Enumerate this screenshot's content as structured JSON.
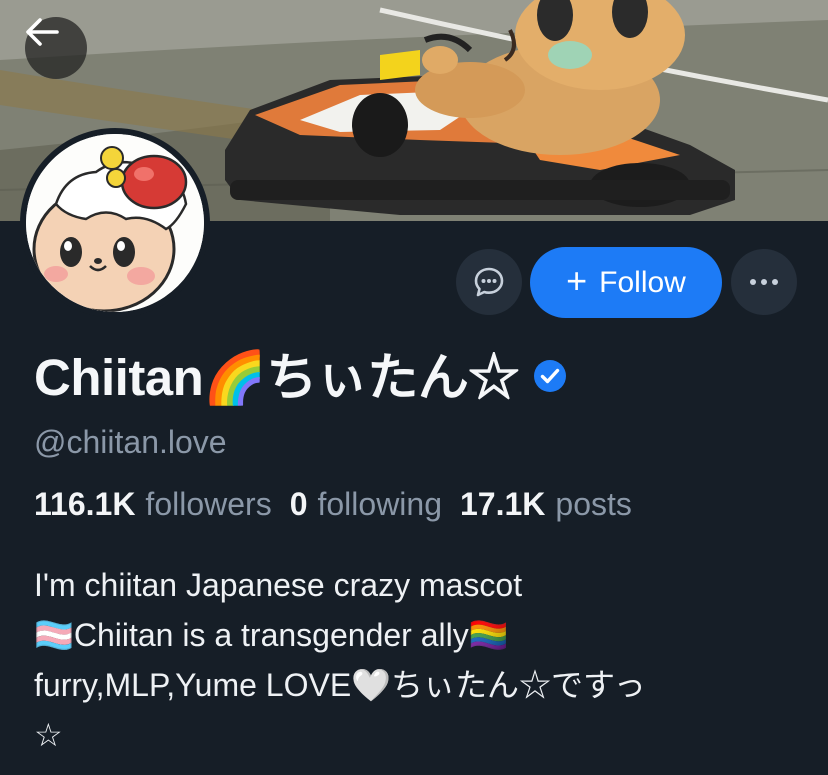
{
  "banner": {
    "description_icon": "kart-banner-image"
  },
  "back_button": {
    "icon": "arrow-left-icon"
  },
  "actions": {
    "message_icon": "chat-bubble-icon",
    "follow_label": "Follow",
    "follow_plus": "+",
    "more_icon": "ellipsis-icon"
  },
  "profile": {
    "display_name": "Chiitan🌈ちぃたん☆",
    "handle": "@chiitan.love",
    "verified": true
  },
  "stats": {
    "followers_count": "116.1K",
    "followers_label": "followers",
    "following_count": "0",
    "following_label": "following",
    "posts_count": "17.1K",
    "posts_label": "posts"
  },
  "bio": {
    "line1": "I'm chiitan Japanese crazy mascot",
    "line2": "🏳️‍⚧️Chiitan is a transgender ally🏳️‍🌈",
    "line3": "furry,MLP,Yume LOVE🤍ちぃたん☆ですっ",
    "line4": "☆"
  },
  "colors": {
    "background": "#161e27",
    "accent": "#1d7bf6",
    "muted_text": "#8b98a8",
    "button_dark": "#252f3b"
  }
}
